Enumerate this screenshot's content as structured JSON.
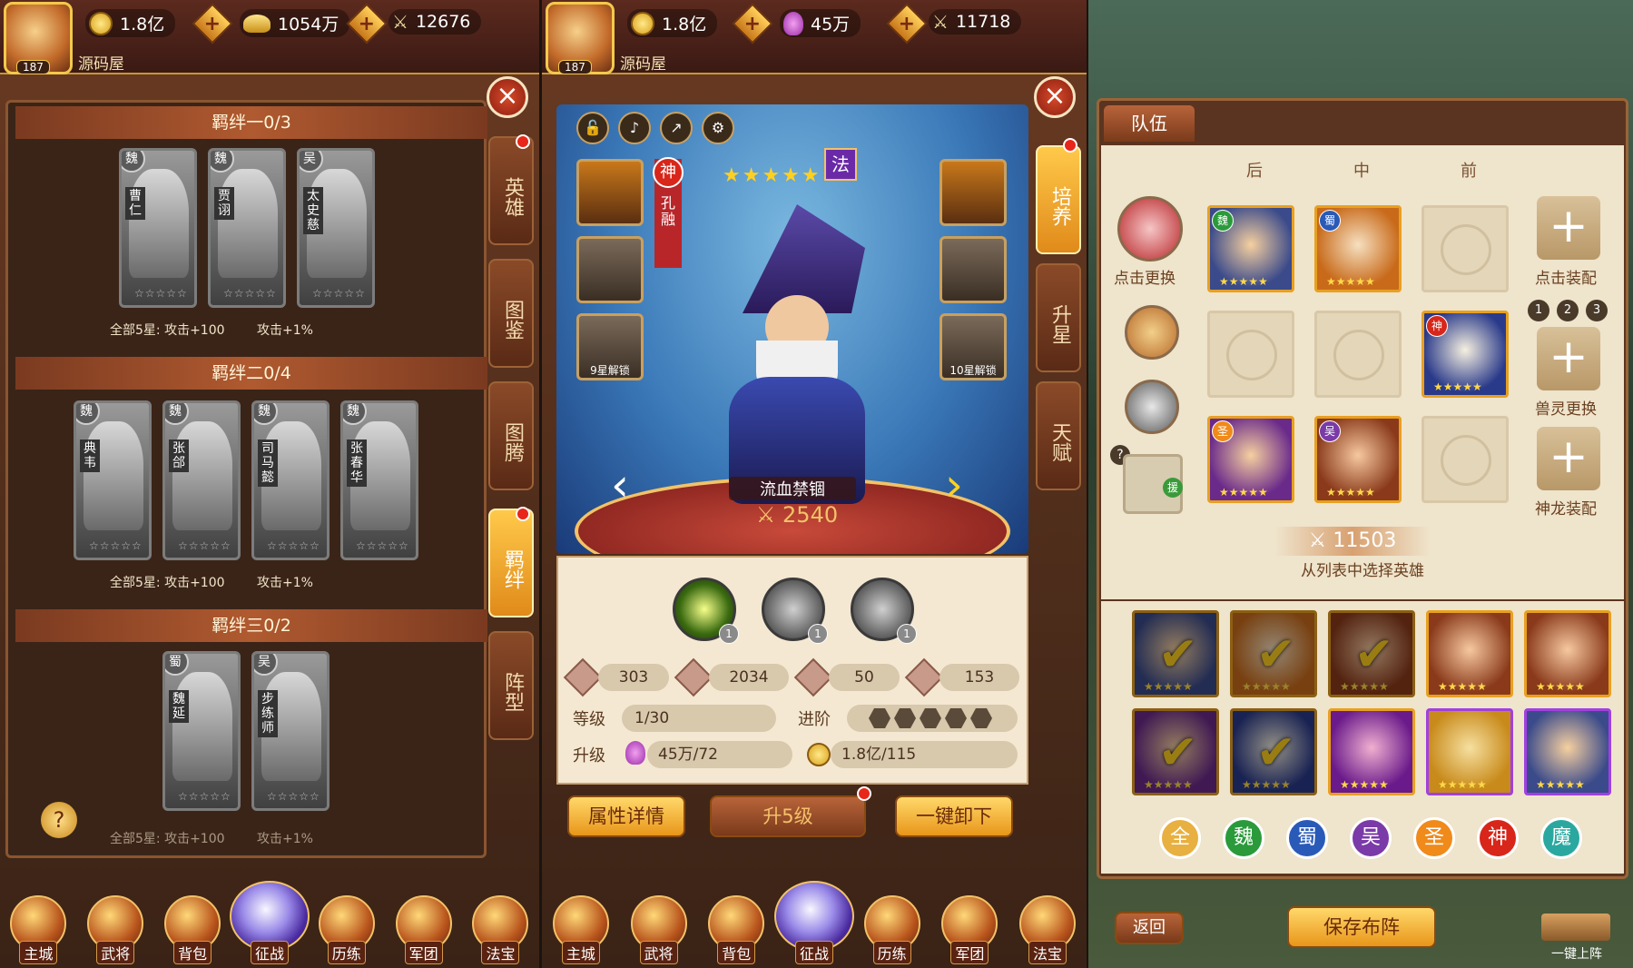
{
  "panel1": {
    "player": {
      "level": "187",
      "name": "源码屋"
    },
    "resources": {
      "coins": "1.8亿",
      "ingots": "1054万",
      "power": "12676"
    },
    "close": "×",
    "bonds": [
      {
        "title": "羁绊一0/3",
        "heroes": [
          {
            "faction": "魏",
            "name": "曹仁"
          },
          {
            "faction": "魏",
            "name": "贾诩"
          },
          {
            "faction": "吴",
            "name": "太史慈"
          }
        ],
        "bonus_a": "全部5星: 攻击+100",
        "bonus_b": "攻击+1%"
      },
      {
        "title": "羁绊二0/4",
        "heroes": [
          {
            "faction": "魏",
            "name": "典韦"
          },
          {
            "faction": "魏",
            "name": "张郃"
          },
          {
            "faction": "魏",
            "name": "司马懿"
          },
          {
            "faction": "魏",
            "name": "张春华"
          }
        ],
        "bonus_a": "全部5星: 攻击+100",
        "bonus_b": "攻击+1%"
      },
      {
        "title": "羁绊三0/2",
        "heroes": [
          {
            "faction": "蜀",
            "name": "魏延"
          },
          {
            "faction": "吴",
            "name": "步练师"
          }
        ],
        "bonus_a": "全部5星: 攻击+100",
        "bonus_b": "攻击+1%"
      }
    ],
    "help": "?",
    "tabs": [
      "英雄",
      "图鉴",
      "图腾",
      "羁绊",
      "阵型"
    ],
    "active_tab": "羁绊"
  },
  "panel2": {
    "player": {
      "level": "187",
      "name": "源码屋"
    },
    "resources": {
      "coins": "1.8亿",
      "potion": "45万",
      "power": "11718"
    },
    "close": "×",
    "hero": {
      "name": "孔融",
      "class_badge": "神",
      "role": "法",
      "stars": "★★★★★",
      "weapon": "流血禁锢",
      "power": "2540"
    },
    "slots": {
      "lock9": "9星解锁",
      "lock10": "10星解锁"
    },
    "skills": [
      "1",
      "1",
      "1"
    ],
    "stats": [
      "303",
      "2034",
      "50",
      "153"
    ],
    "level_label": "等级",
    "level_value": "1/30",
    "advance_label": "进阶",
    "upgrade_label": "升级",
    "upgrade_potion": "45万/72",
    "upgrade_coin": "1.8亿/115",
    "buttons": {
      "detail": "属性详情",
      "upgrade": "升5级",
      "unequip": "一键卸下"
    },
    "tabs": [
      "培养",
      "升星",
      "天赋"
    ]
  },
  "panel3": {
    "tab": "队伍",
    "positions": [
      "后",
      "中",
      "前"
    ],
    "left_controls": {
      "swap": "点击更换",
      "q": "?",
      "help_badge": "援"
    },
    "right_controls": {
      "equip": "点击装配",
      "beast": "兽灵更换",
      "dragon": "神龙装配",
      "nums": [
        "1",
        "2",
        "3"
      ]
    },
    "power": "11503",
    "hint": "从列表中选择英雄",
    "factions": [
      "全",
      "魏",
      "蜀",
      "吴",
      "圣",
      "神",
      "魔"
    ],
    "faction_colors": [
      "#e8b040",
      "#2a9a3a",
      "#2a5ab8",
      "#7a3aa8",
      "#f08a1a",
      "#d8261a",
      "#2aa8a0"
    ],
    "back": "返回",
    "save": "保存布阵",
    "auto": "一键上阵"
  },
  "bottom_nav": [
    "主城",
    "武将",
    "背包",
    "征战",
    "历练",
    "军团",
    "法宝"
  ]
}
